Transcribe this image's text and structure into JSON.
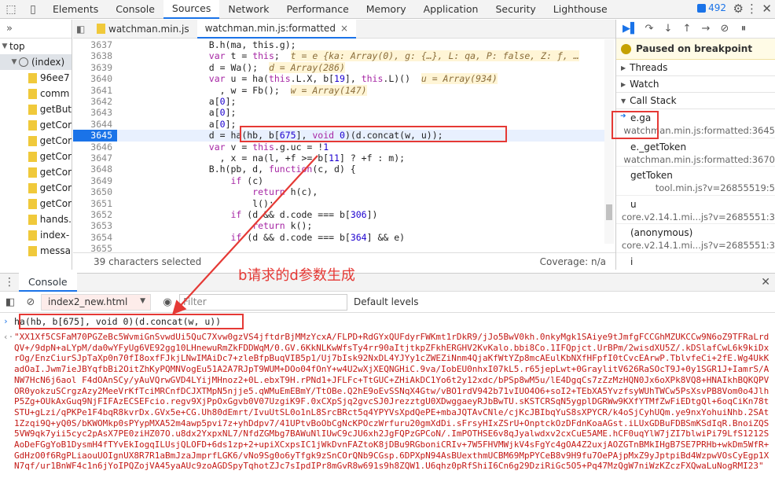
{
  "topbar": {
    "tabs": [
      "Elements",
      "Console",
      "Sources",
      "Network",
      "Performance",
      "Memory",
      "Application",
      "Security",
      "Lighthouse"
    ],
    "active_tab": "Sources",
    "issues_count": "492"
  },
  "tree": {
    "items": [
      "top",
      "(index)",
      "96ee7",
      "comm",
      "getBut",
      "getCor",
      "getCor",
      "getCor",
      "getCor",
      "getCor",
      "getCor",
      "hands.",
      "index-",
      "messa"
    ]
  },
  "editor": {
    "tabs": [
      "watchman.min.js",
      "watchman.min.js:formatted"
    ],
    "active_tab": "watchman.min.js:formatted",
    "line_numbers": [
      "3637",
      "3638",
      "3639",
      "3640",
      "3641",
      "3642",
      "3643",
      "3644",
      "3645",
      "3646",
      "3647",
      "3648",
      "3649",
      "3650",
      "3651",
      "3652",
      "3653",
      "3654",
      "3655",
      "3656"
    ],
    "current_line": "3645",
    "status_left": "39 characters selected",
    "status_right": "Coverage: n/a"
  },
  "debugger": {
    "paused_label": "Paused on breakpoint",
    "sections": [
      "Threads",
      "Watch",
      "Call Stack"
    ],
    "call_stack": [
      {
        "fn": "e.ga",
        "loc": "watchman.min.js:formatted:3645"
      },
      {
        "fn": "e._getToken",
        "loc": "watchman.min.js:formatted:3670"
      },
      {
        "fn": "getToken",
        "loc": "tool.min.js?v=26855519:5"
      },
      {
        "fn": "u",
        "loc": "core.v2.14.1.mi...js?v=2685551:3"
      },
      {
        "fn": "(anonymous)",
        "loc": "core.v2.14.1.mi...js?v=2685551:3"
      },
      {
        "fn": "i",
        "loc": ""
      }
    ]
  },
  "drawer": {
    "tab": "Console",
    "context": "index2_new.html",
    "filter_placeholder": "Filter",
    "levels": "Default levels",
    "command": "ha(hb, b[675], void 0)(d.concat(w, u))",
    "result": "\"XX1Xf5CSFaM70PGZeBc5WvmiGnSvwdUi5QuC7Xvw0gzVS4jftdrBjMMzYcxA/FLPD+RdGYxQUFdyrFWKmt1rDkR9/jJo5BwV0kh.0nkyMgk1SAiye9tJmfgFCCGhMZUKCCw9N6oZ9TFRaLrdQV+/9dpN+aLYpM/da0wYFyUg6VE92gg10LHnewuRmZkFDDWqM/0.GV.6KkNLKwWfsTy4rr90aItjtkpZFkhERGHV2KvKalo.bbi8Co.1IFQpjct.UrBPm/2wisdXU5Z/.kDSlafCwL6k9kiDxrOg/EnzCiurSJpTaXp0n70fI8oxfFJkjLNwIMAiDc7+zleBfpBuqVIB5p1/Uj7bIsk92NxDL4YJYy1cZWEZiNnm4QjaKfWtYZp8mcAEulKbNXfHFpfI0tCvcEArwP.TblvfeCi+2fE.Wg4UkKadOaI.Jwm7ieJBYqfbBi2OitZhKyPQMNVogEu51A2A7RJpT9WUM+DOo04fOnY+w4U2wXjXEQNGHiC.9va/IobEU0nhxI07kL5.r65jepLwt+0GraylitV626RaSOcT9J+0y1SGR1J+IamrS/ANW7HcN6j6aol F4dOAnSCy/yAuVQrwGVD4LYijMHnoz2+0L.ebxT9H.rPNd1+JFLFc+TtGUC+ZHiAkDC1Yo6t2y12xdc/bPSp8wM5u/lE4DgqCs7zZzMzHQN0Jx6oXPk8VQ8+HNAIkhBQKQPVOR0yokzuSCrgzAzy2MeeVrKfTciMRCnfDCJXTMpN5njje5.qWMuEmEBmY/TtOBe.Q2hE9oEvSSNqX4Gtw/vBO1rdV942b71vIUO4O6+soI2+TEbXA5YvzfsyWUhTWCw5PsXsvPB8Vom0o4JlhP5Zg+OUkAxGuq9NjFIFAzECSEFcio.regv9XjPpOxGgvb0V07UzgiK9F.0xCXpSjq2gvcSJ0JrezztgU0XDwggaeyRJbBwTU.sKSTCRSqN5ygplDGRWw9KXfYTMfZwFiEDtgQl+6oqCiKn78tSTU+gLzi/qPKPe1F4bqR8kvrDx.GVx5e+CG.Uh80dEmrt/IvuUtSL0o1nL8SrcBRct5q4YPYVsXpdQePE+mbaJQTAvCNle/cjKcJBIbqYuS8sXPYCR/k4oSjCyhUQm.ye9nxYohuiNhb.2SAt1Zzqi9Q+yQ0S/bKWOMkp0sPYypMXA52m4awp5pvi7z+yhDdpv7/41UPtvBoObCgNcKPOczWrfuru20gmXdDi.sFrsyHIxZSrU+OnptckOzDFdnKoaAGst.iLUxGDBuFDBSmKSdIqR.BnoiZQS5VW9qk7yii5cyc2pAsX7PE0ziHZ07O.u8dx2YxpxNL7/NfdZGMbg7BAWuNlIUwC9cJU6xh2JgFQPzGPCoN/.ImPOTHSE6v8qJyalwdxv2cxCuE5AME.hCF0uqYlW7jZI7blwiPi79LfS1212SAoDeFGgYoB1DysmH4fTYvEkIogqILUsjQLOFD+6ds1zp+2+upiXCxpsIC1jWkDvnFAZtoK8jDBu9RGboniCRIv+7W5FHVMWjkV4sFgYc4gOA4Z2uxjAOZGTnBMkIHgB7SE7PRHb+wkDm5WfR+GdHzO0f6RgPLiaouUOIgnUX8R7R1aBmJzaJmprfLGK6/vNo9Sg0o6yTfgk9zSnCOrQNb9CGsp.6DPXpN94AsBUexthmUCBM69MpPYCeB8v9H9fu7OePAjpMxZ9yJptpiBd4WzpwVOsCyEgp1XN7qf/ur1BnWF4c1n6jYoIPQZojVA45yaAUc9zoAGDSpyTqhotZJc7sIpdIPr8mGvR8w691s9h8ZQW1.U6qhz0pRfShiI6Cn6g29DziRiGc5O5+Pq47MzQgW7niWzKZczFXQwaLuNogRMI23\""
  },
  "annotation": {
    "text": "b请求的d参数生成"
  }
}
